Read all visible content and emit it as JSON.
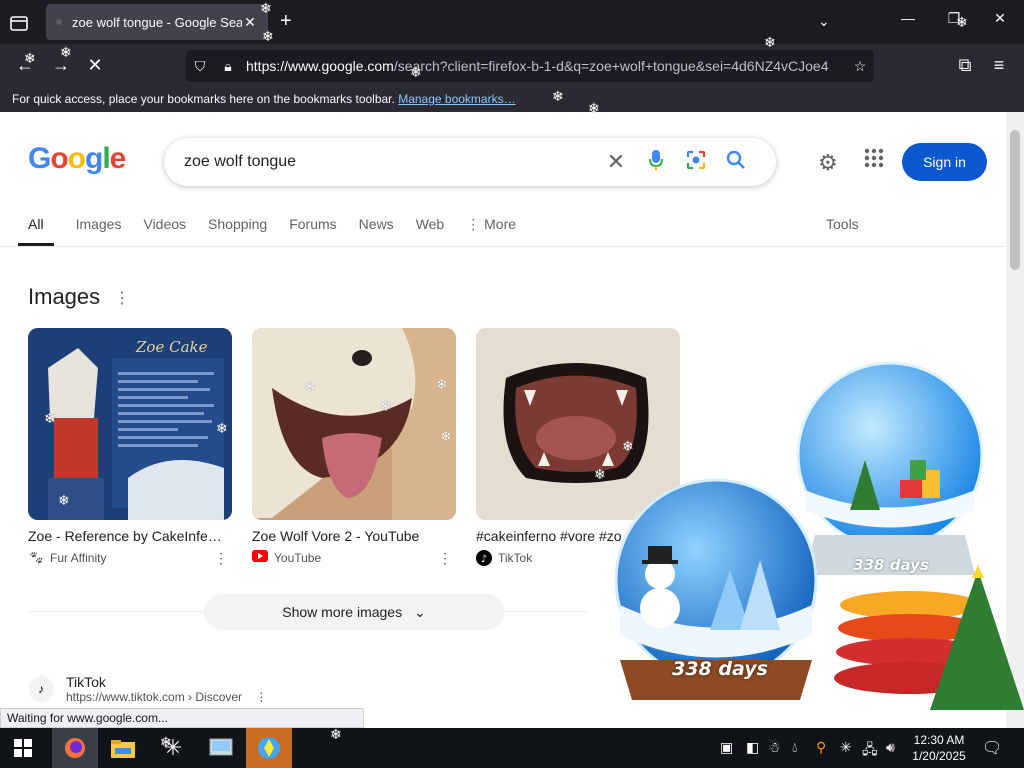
{
  "browser": {
    "tab_title": "zoe wolf tongue - Google Search",
    "url_host": "https://www.google.com",
    "url_rest": "/search?client=firefox-b-1-d&q=zoe+wolf+tongue&sei=4d6NZ4vCJoe4",
    "bookmarks_prompt": "For quick access, place your bookmarks here on the bookmarks toolbar.",
    "bookmarks_link": "Manage bookmarks…",
    "status_text": "Waiting for www.google.com..."
  },
  "google": {
    "query": "zoe wolf tongue",
    "sign_in": "Sign in",
    "tabs": [
      "All",
      "Images",
      "Videos",
      "Shopping",
      "Forums",
      "News",
      "Web",
      "⋮ More"
    ],
    "tools": "Tools",
    "images_heading": "Images",
    "image_results": [
      {
        "caption": "Zoe - Reference by CakeInfe…",
        "source": "Fur Affinity",
        "thumb_title": "Zoe Cake"
      },
      {
        "caption": "Zoe Wolf Vore 2 - YouTube",
        "source": "YouTube"
      },
      {
        "caption": "#cakeinferno #vore #zo…",
        "source": "TikTok"
      }
    ],
    "show_more": "Show more images",
    "web_result": {
      "name": "TikTok",
      "url": "https://www.tiktok.com › Discover"
    }
  },
  "desktop": {
    "globe_days_1": "338 days",
    "globe_days_2": "338 days"
  },
  "taskbar": {
    "time": "12:30 AM",
    "date": "1/20/2025"
  },
  "colors": {
    "signin_blue": "#0b57d0",
    "firefox_dark": "#1c1b22",
    "link_blue": "#8cc7ff"
  }
}
